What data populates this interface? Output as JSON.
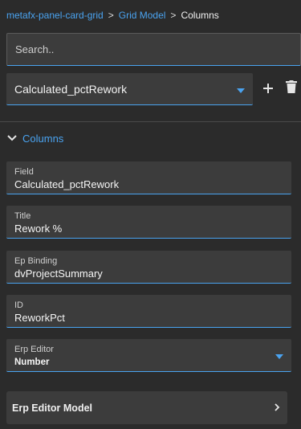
{
  "breadcrumb": {
    "items": [
      "metafx-panel-card-grid",
      "Grid Model"
    ],
    "separator": ">",
    "current": "Columns"
  },
  "search": {
    "placeholder": "Search.."
  },
  "selector": {
    "value": "Calculated_pctRework"
  },
  "actions": {
    "add_icon": "plus-icon",
    "delete_icon": "trash-icon"
  },
  "section": {
    "title": "Columns",
    "expanded": true
  },
  "fields": [
    {
      "label": "Field",
      "value": "Calculated_pctRework"
    },
    {
      "label": "Title",
      "value": "Rework %"
    },
    {
      "label": "Ep Binding",
      "value": "dvProjectSummary"
    },
    {
      "label": "ID",
      "value": "ReworkPct"
    },
    {
      "label": "Erp Editor",
      "value": "Number"
    }
  ],
  "model_row": {
    "label": "Erp Editor Model"
  },
  "colors": {
    "accent": "#4aa3f0",
    "background": "#2b2b2b",
    "panel": "#3c3c3c"
  }
}
